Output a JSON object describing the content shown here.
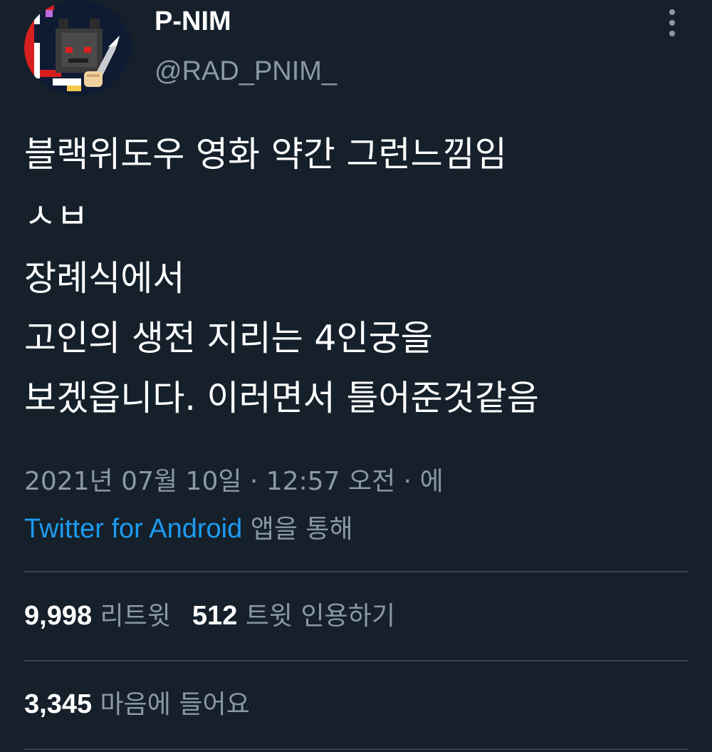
{
  "author": {
    "name": "P-NIM",
    "handle": "@RAD_PNIM_",
    "avatar_icon": "pixel-character-with-knife-icon"
  },
  "tweet": {
    "lines": [
      "블랙위도우 영화 약간 그런느낌임",
      "ㅅㅂ",
      "장례식에서",
      "고인의 생전 지리는 4인궁을",
      "보겠읍니다. 이러면서 틀어준것같음"
    ]
  },
  "meta": {
    "timestamp": "2021년 07월 10일 · 12:57 오전 · 에",
    "source_app": "Twitter for Android",
    "source_suffix": " 앱을 통해"
  },
  "stats": {
    "retweets_count": "9,998",
    "retweets_label": "리트윗",
    "quotes_count": "512",
    "quotes_label": "트윗 인용하기",
    "likes_count": "3,345",
    "likes_label": "마음에 들어요"
  },
  "colors": {
    "background": "#15202b",
    "primary_text": "#ffffff",
    "secondary_text": "#8b98a5",
    "link": "#1d9bf0",
    "divider": "#38444d"
  }
}
